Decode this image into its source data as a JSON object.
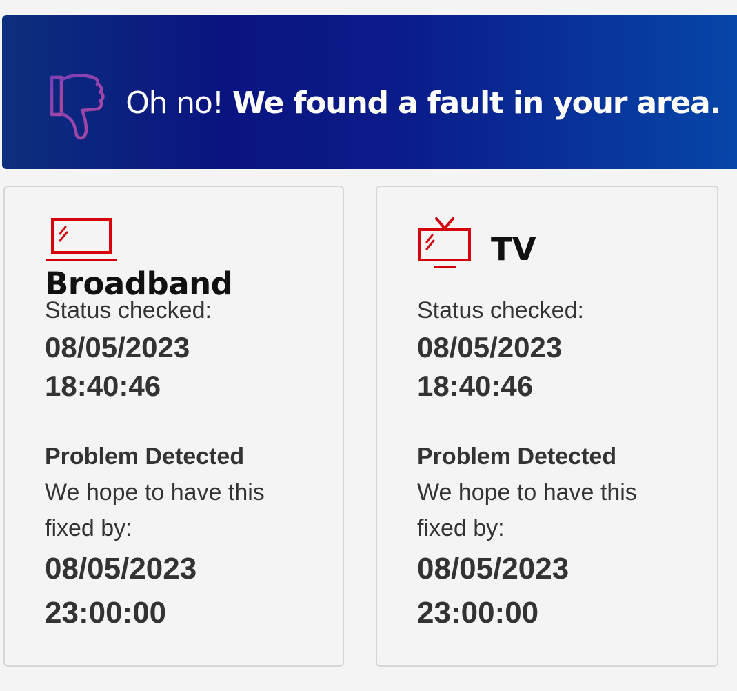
{
  "banner": {
    "prefix": "Oh no!",
    "message": "We found a fault in your area.",
    "icon": "thumbs-down-icon"
  },
  "colors": {
    "banner_dark": "#0a1480",
    "banner_light": "#0646a8",
    "icon_red": "#d6000a",
    "icon_purple": "#8a4fc0"
  },
  "cards": [
    {
      "title": "Broadband",
      "icon": "laptop-icon",
      "status_label": "Status checked:",
      "status_date": "08/05/2023",
      "status_time": "18:40:46",
      "problem_label": "Problem Detected",
      "hope_line_1": "We hope to have this",
      "hope_line_2": "fixed by:",
      "fix_date": "08/05/2023",
      "fix_time": "23:00:00"
    },
    {
      "title": "TV",
      "icon": "tv-icon",
      "status_label": "Status checked:",
      "status_date": "08/05/2023",
      "status_time": "18:40:46",
      "problem_label": "Problem Detected",
      "hope_line_1": "We hope to have this",
      "hope_line_2": "fixed by:",
      "fix_date": "08/05/2023",
      "fix_time": "23:00:00"
    }
  ]
}
